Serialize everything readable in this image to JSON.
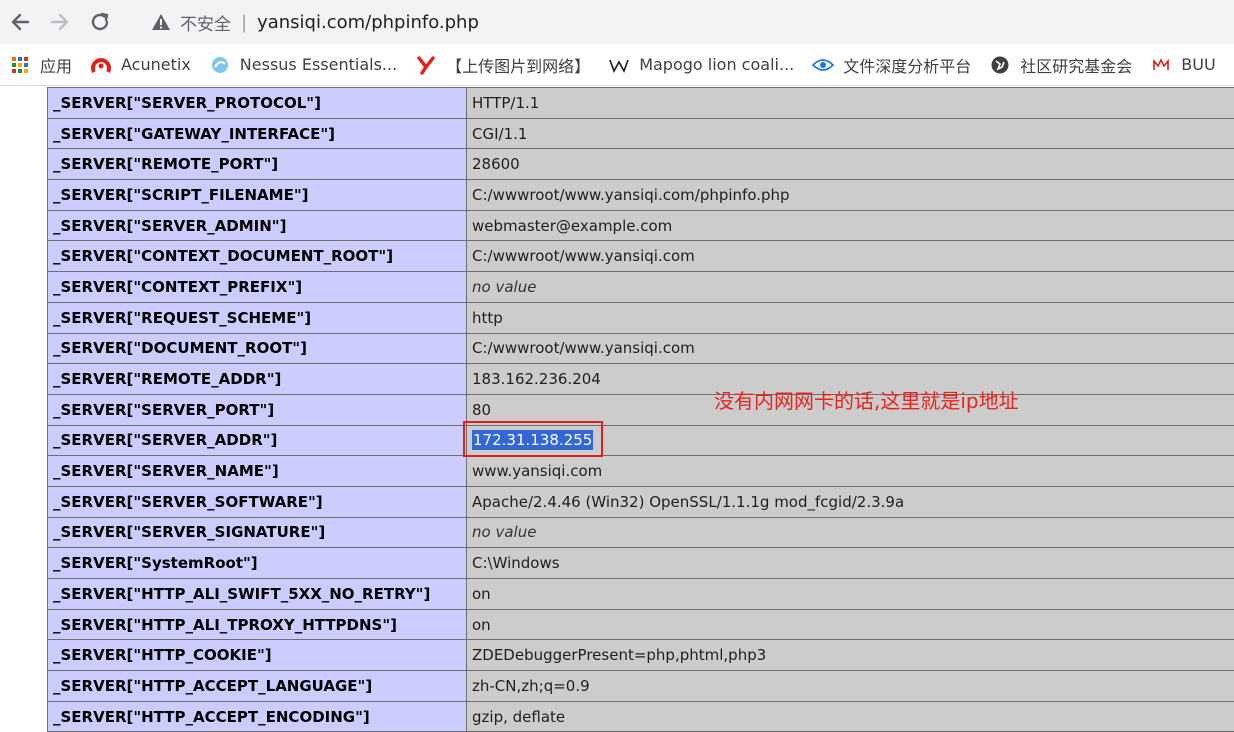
{
  "browser": {
    "security_label": "不安全",
    "separator": "|",
    "url": "yansiqi.com/phpinfo.php"
  },
  "bookmarks": [
    {
      "label": "应用",
      "icon": "apps-grid-icon"
    },
    {
      "label": "Acunetix",
      "icon": "acunetix-icon"
    },
    {
      "label": "Nessus Essentials...",
      "icon": "nessus-icon"
    },
    {
      "label": "【上传图片到网络】",
      "icon": "y-logo-icon"
    },
    {
      "label": "Mapogo lion coali...",
      "icon": "wikipedia-w-icon"
    },
    {
      "label": "文件深度分析平台",
      "icon": "eye-icon"
    },
    {
      "label": "社区研究基金会",
      "icon": "globe-icon"
    },
    {
      "label": "BUU",
      "icon": "buu-icon"
    }
  ],
  "rows": [
    {
      "key": "_SERVER[\"SERVER_PROTOCOL\"]",
      "value": "HTTP/1.1"
    },
    {
      "key": "_SERVER[\"GATEWAY_INTERFACE\"]",
      "value": "CGI/1.1"
    },
    {
      "key": "_SERVER[\"REMOTE_PORT\"]",
      "value": "28600"
    },
    {
      "key": "_SERVER[\"SCRIPT_FILENAME\"]",
      "value": "C:/wwwroot/www.yansiqi.com/phpinfo.php"
    },
    {
      "key": "_SERVER[\"SERVER_ADMIN\"]",
      "value": "webmaster@example.com"
    },
    {
      "key": "_SERVER[\"CONTEXT_DOCUMENT_ROOT\"]",
      "value": "C:/wwwroot/www.yansiqi.com"
    },
    {
      "key": "_SERVER[\"CONTEXT_PREFIX\"]",
      "value": "no value"
    },
    {
      "key": "_SERVER[\"REQUEST_SCHEME\"]",
      "value": "http"
    },
    {
      "key": "_SERVER[\"DOCUMENT_ROOT\"]",
      "value": "C:/wwwroot/www.yansiqi.com"
    },
    {
      "key": "_SERVER[\"REMOTE_ADDR\"]",
      "value": "183.162.236.204"
    },
    {
      "key": "_SERVER[\"SERVER_PORT\"]",
      "value": "80"
    },
    {
      "key": "_SERVER[\"SERVER_ADDR\"]",
      "value": "172.31.138.255"
    },
    {
      "key": "_SERVER[\"SERVER_NAME\"]",
      "value": "www.yansiqi.com"
    },
    {
      "key": "_SERVER[\"SERVER_SOFTWARE\"]",
      "value": "Apache/2.4.46 (Win32) OpenSSL/1.1.1g mod_fcgid/2.3.9a"
    },
    {
      "key": "_SERVER[\"SERVER_SIGNATURE\"]",
      "value": "no value"
    },
    {
      "key": "_SERVER[\"SystemRoot\"]",
      "value": "C:\\Windows"
    },
    {
      "key": "_SERVER[\"HTTP_ALI_SWIFT_5XX_NO_RETRY\"]",
      "value": "on"
    },
    {
      "key": "_SERVER[\"HTTP_ALI_TPROXY_HTTPDNS\"]",
      "value": "on"
    },
    {
      "key": "_SERVER[\"HTTP_COOKIE\"]",
      "value": "ZDEDebuggerPresent=php,phtml,php3"
    },
    {
      "key": "_SERVER[\"HTTP_ACCEPT_LANGUAGE\"]",
      "value": "zh-CN,zh;q=0.9"
    },
    {
      "key": "_SERVER[\"HTTP_ACCEPT_ENCODING\"]",
      "value": "gzip, deflate"
    }
  ],
  "annotation": "没有内网网卡的话,这里就是ip地址",
  "colors": {
    "key_cell": "#ccccff",
    "value_cell": "#cccccc",
    "annotation": "#e8241f",
    "selection": "#3367d6"
  }
}
